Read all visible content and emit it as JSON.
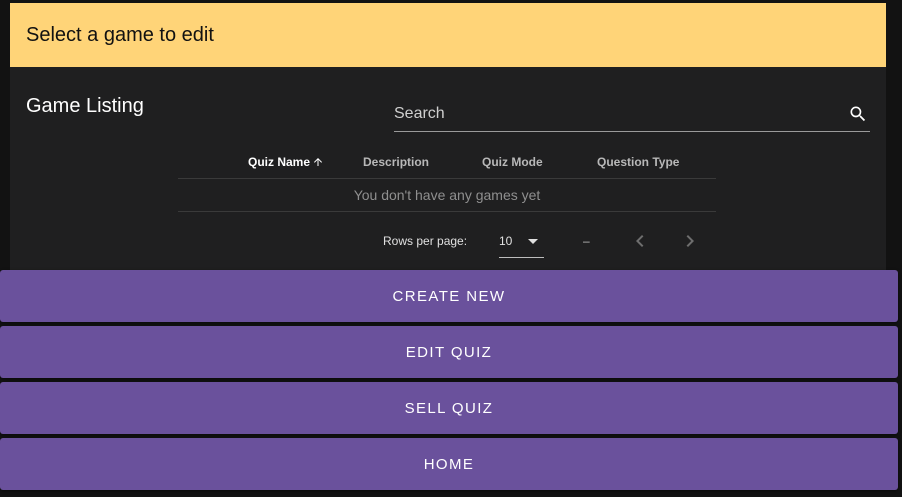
{
  "banner": {
    "text": "Select a game to edit"
  },
  "listing": {
    "title": "Game Listing",
    "search": {
      "placeholder": "Search",
      "value": ""
    },
    "columns": [
      "Quiz Name",
      "Description",
      "Quiz Mode",
      "Question Type"
    ],
    "sorted_column": "Quiz Name",
    "empty_message": "You don't have any games yet",
    "pagination": {
      "rows_per_page_label": "Rows per page:",
      "rows_per_page": "10",
      "range": "–"
    }
  },
  "actions": {
    "create_new": "CREATE NEW",
    "edit_quiz": "EDIT QUIZ",
    "sell_quiz": "SELL QUIZ",
    "home": "HOME"
  },
  "colors": {
    "banner": "#ffd478",
    "panel": "#1f1f20",
    "button": "#6a519c",
    "background": "#121212"
  },
  "icons": [
    "search-icon",
    "arrow-up-icon",
    "chevron-down-icon",
    "chevron-left-icon",
    "chevron-right-icon"
  ]
}
